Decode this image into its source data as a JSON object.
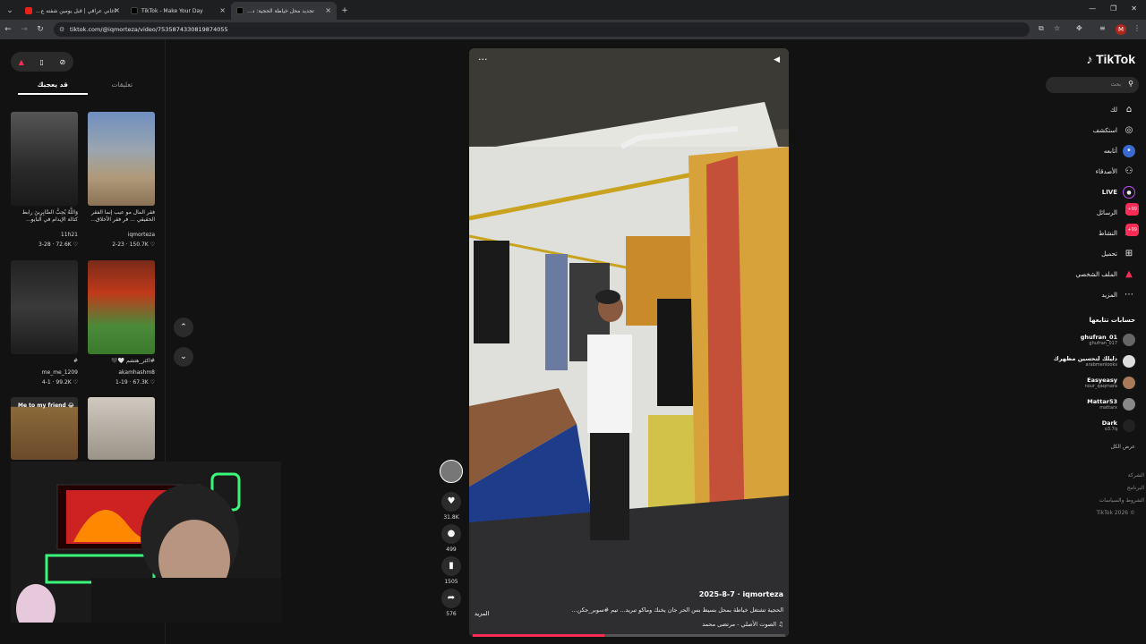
{
  "browser": {
    "tabs": [
      {
        "title": "اغاني عراقي | قبل يومين شفته ع...",
        "active": false
      },
      {
        "title": "TikTok - Make Your Day",
        "active": false
      },
      {
        "title": "تجديد محل خياطة الحجية: د...",
        "active": true
      }
    ],
    "url": "tiktok.com/@iqmorteza/video/7535874330819874055"
  },
  "left_panel": {
    "tab_for_you": "قد يعجبك",
    "tab_comments": "تعليقات",
    "items": [
      {
        "caption": "وَاللَّهُ يُحِبُّ الصَّابِرِينَ رابط كتالة الإيدام في البايو...",
        "user": "11h21",
        "date": "3-28",
        "likes": "72.6K"
      },
      {
        "caption": "فقر المال مو عيب إنما الفقر الحقيقي ... فر فقر الأخلاق...",
        "user": "iqmorteza",
        "date": "2-23",
        "likes": "150.7K"
      },
      {
        "caption": "#",
        "user": "me_me_1209",
        "date": "4-1",
        "likes": "99.2K"
      },
      {
        "caption": "#اكثر_هتشم 🤍🖤",
        "user": "akamhashm8",
        "date": "1-19",
        "likes": "67.3K"
      }
    ],
    "thumb3_text": "Me to my friend 😂"
  },
  "video": {
    "author": "iqmorteza",
    "date": "2025-8-7",
    "caption": "الحجية تشتغل خياطة بمحل بسيط بس الحر جان يخنك وماكو تبريد... تيم #سوبر_جكن...",
    "more": "المزيد",
    "sound": "♫ الصوت الأصلي - مرتضى محمد",
    "progress": 0.42,
    "likes": "31.8K",
    "comments": "499",
    "saves": "1505",
    "shares": "576"
  },
  "right_nav": {
    "logo": "TikTok",
    "search_placeholder": "بحث",
    "items": [
      {
        "label": "لك",
        "icon": "home-icon"
      },
      {
        "label": "استكشف",
        "icon": "compass-icon"
      },
      {
        "label": "أتابعه",
        "icon": "following-icon"
      },
      {
        "label": "الأصدقاء",
        "icon": "friends-icon"
      },
      {
        "label": "LIVE",
        "icon": "live-icon"
      },
      {
        "label": "الرسائل",
        "icon": "messages-icon",
        "badge": "99+"
      },
      {
        "label": "النشاط",
        "icon": "activity-icon",
        "badge": "99+"
      },
      {
        "label": "تحميل",
        "icon": "upload-icon"
      },
      {
        "label": "الملف الشخصي",
        "icon": "profile-icon"
      },
      {
        "label": "المزيد",
        "icon": "more-icon"
      }
    ],
    "following_title": "حسابات تتابعها",
    "accounts": [
      {
        "name": "ghufran_01",
        "handle": "ghufran_017"
      },
      {
        "name": "دليلك لتحسين مظهرك",
        "handle": "arabmenlooks"
      },
      {
        "name": "Easyeasy",
        "handle": "nour_qaqmara"
      },
      {
        "name": "Mattar53",
        "handle": "mattarx"
      },
      {
        "name": "Dark",
        "handle": "o3.7q"
      }
    ],
    "see_all": "عرض الكل",
    "footer": [
      "الشركة",
      "البرنامج",
      "الشروط والسياسات",
      "TikTok 2026 ©"
    ]
  }
}
